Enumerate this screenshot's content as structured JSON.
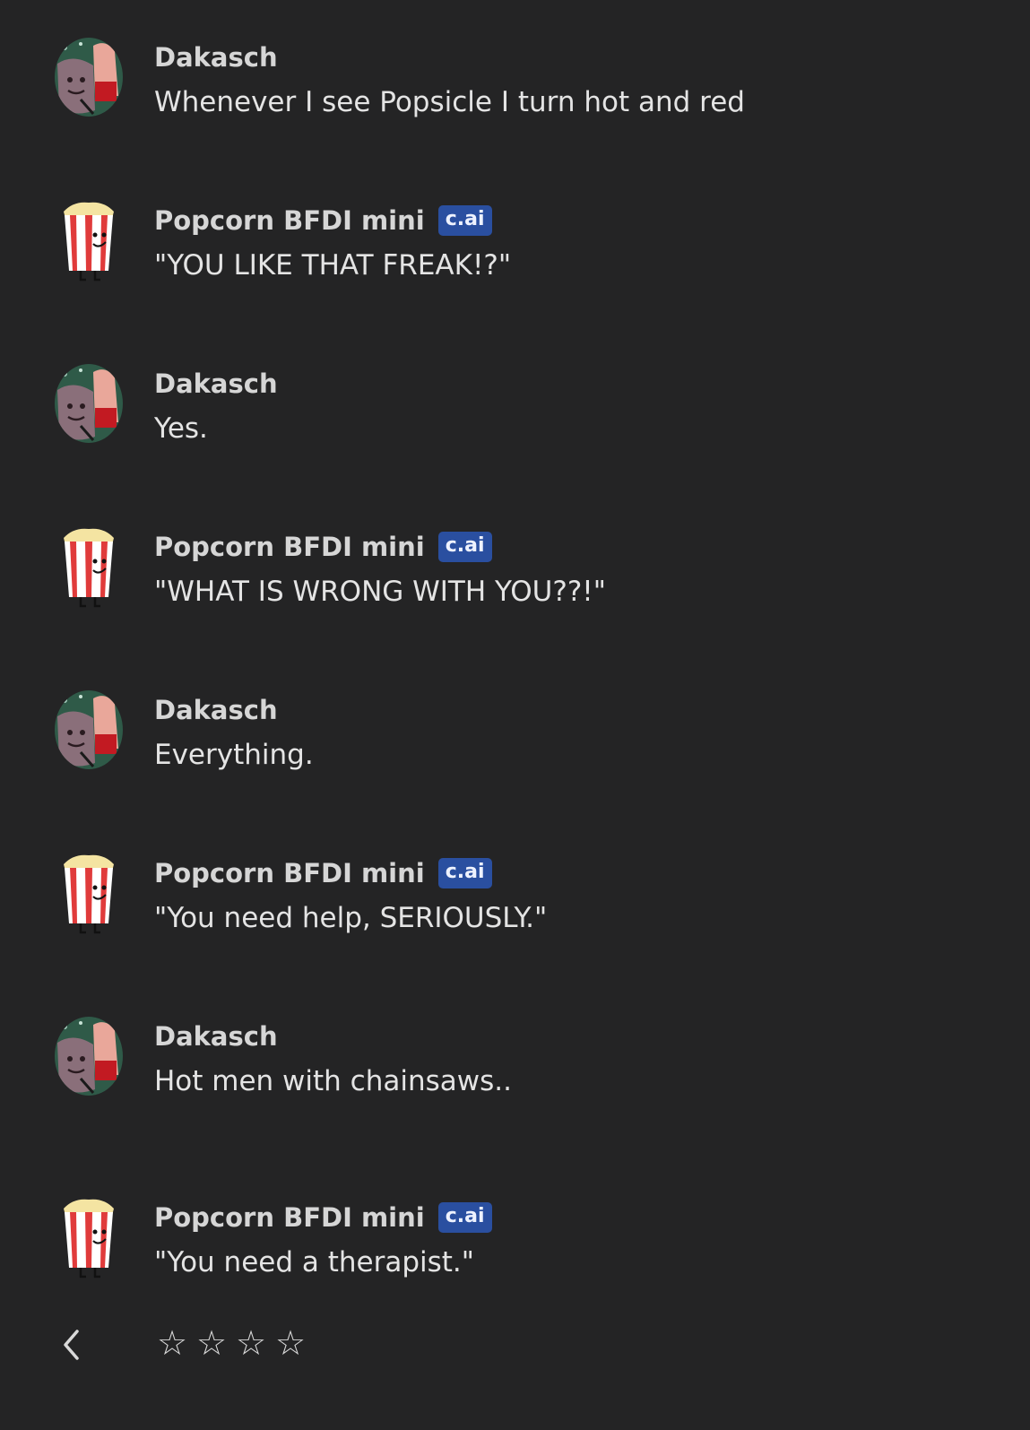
{
  "messages": [
    {
      "author": "Dakasch",
      "avatar": "user-avatar-icon",
      "badge": "",
      "text": "Whenever I see Popsicle I turn hot and red"
    },
    {
      "author": "Popcorn BFDI mini",
      "avatar": "popcorn-avatar-icon",
      "badge": "c.ai",
      "text": "\"YOU LIKE THAT FREAK!?\""
    },
    {
      "author": "Dakasch",
      "avatar": "user-avatar-icon",
      "badge": "",
      "text": "Yes."
    },
    {
      "author": "Popcorn BFDI mini",
      "avatar": "popcorn-avatar-icon",
      "badge": "c.ai",
      "text": "\"WHAT IS WRONG WITH YOU??!\""
    },
    {
      "author": "Dakasch",
      "avatar": "user-avatar-icon",
      "badge": "",
      "text": "Everything."
    },
    {
      "author": "Popcorn BFDI mini",
      "avatar": "popcorn-avatar-icon",
      "badge": "c.ai",
      "text": "\"You need help, SERIOUSLY.\""
    },
    {
      "author": "Dakasch",
      "avatar": "user-avatar-icon",
      "badge": "",
      "text": "Hot men with chainsaws.."
    },
    {
      "author": "Popcorn BFDI mini",
      "avatar": "popcorn-avatar-icon",
      "badge": "c.ai",
      "text": "\"You need a therapist.\""
    }
  ],
  "footer": {
    "back_icon": "chevron-left-icon",
    "rating": {
      "filled": 0,
      "max": 4,
      "star_glyph": "☆"
    }
  },
  "colors": {
    "background": "#242425",
    "badge": "#2a4fa0"
  }
}
